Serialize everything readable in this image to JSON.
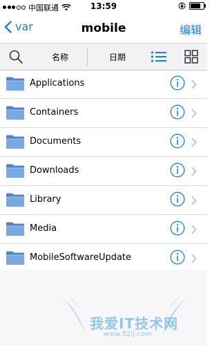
{
  "status_bar": {
    "carrier": "中国联通",
    "time": "13:59"
  },
  "nav": {
    "back_label": "var",
    "title": "mobile",
    "edit_label": "编辑"
  },
  "toolbar": {
    "name_label": "名称",
    "date_label": "日期"
  },
  "files": [
    {
      "name": "Applications"
    },
    {
      "name": "Containers"
    },
    {
      "name": "Documents"
    },
    {
      "name": "Downloads"
    },
    {
      "name": "Library"
    },
    {
      "name": "Media"
    },
    {
      "name": "MobileSoftwareUpdate"
    }
  ],
  "watermark": {
    "text": "我爱IT技术网",
    "url": "www.52ij.com"
  },
  "colors": {
    "accent": "#1a7ee6",
    "folder": "#5b8fd0"
  },
  "battery_level": 0.9
}
